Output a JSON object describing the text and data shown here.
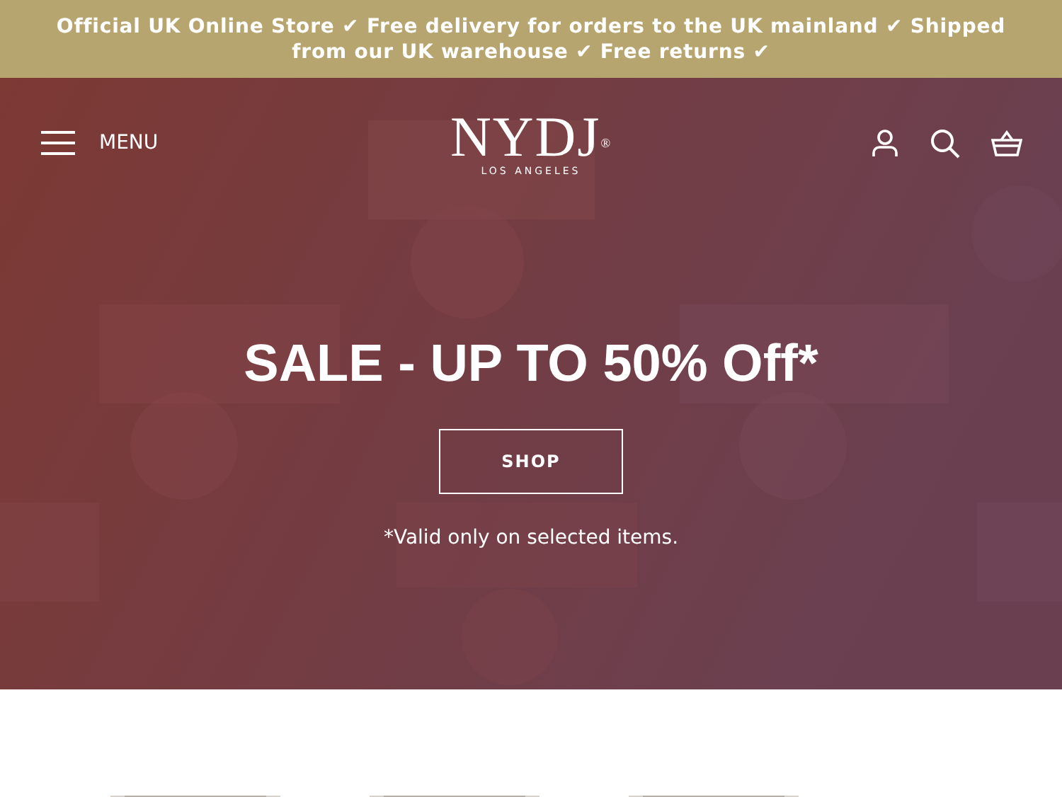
{
  "announcement": "Official UK Online Store ✔ Free delivery for orders to the UK mainland ✔ Shipped from our UK warehouse ✔ Free returns ✔",
  "header": {
    "menu_label": "MENU",
    "logo": "NYDJ$^{®}$",
    "logo_tagline": "LOS ANGELES"
  },
  "hero": {
    "kind": "picture",
    "heading": "SALE - UP TO 50% Off*",
    "button": "SHOP",
    "note": "*Valid only on selected items."
  }
}
